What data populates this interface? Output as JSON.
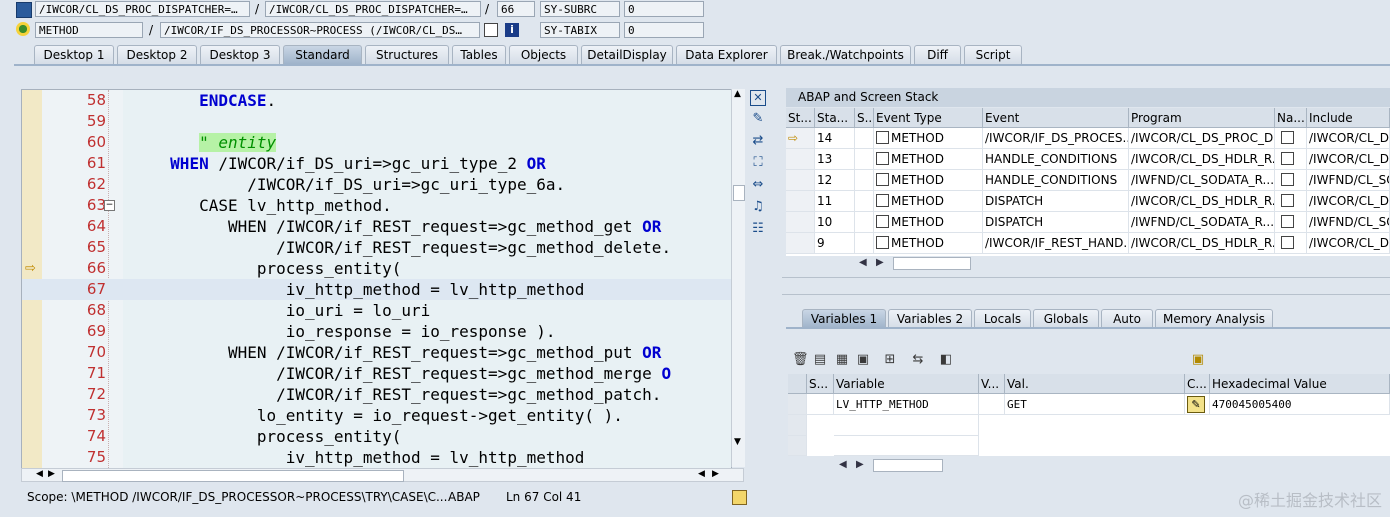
{
  "top_fields": {
    "row1": {
      "program": "/IWCOR/CL_DS_PROC_DISPATCHER=…",
      "include": "/IWCOR/CL_DS_PROC_DISPATCHER=…",
      "line": "66",
      "sysvar": "SY-SUBRC",
      "sysval": "0"
    },
    "row2": {
      "event_type": "METHOD",
      "event": "/IWCOR/IF_DS_PROCESSOR~PROCESS (/IWCOR/CL_DS…",
      "sysvar": "SY-TABIX",
      "sysval": "0"
    },
    "sep": "/",
    "info_icon": "i"
  },
  "tabs": [
    "Desktop 1",
    "Desktop 2",
    "Desktop 3",
    "Standard",
    "Structures",
    "Tables",
    "Objects",
    "DetailDisplay",
    "Data Explorer",
    "Break./Watchpoints",
    "Diff",
    "Script"
  ],
  "code": {
    "lines": [
      {
        "n": "58",
        "segs": [
          {
            "t": "        "
          },
          {
            "t": "ENDCASE",
            "c": "kw"
          },
          {
            "t": "."
          }
        ]
      },
      {
        "n": "59",
        "segs": [
          {
            "t": ""
          }
        ]
      },
      {
        "n": "60",
        "segs": [
          {
            "t": "        "
          },
          {
            "t": "\" entity",
            "c": "cm"
          }
        ]
      },
      {
        "n": "61",
        "segs": [
          {
            "t": "     "
          },
          {
            "t": "WHEN",
            "c": "kw"
          },
          {
            "t": " /IWCOR/if_DS_uri=>gc_uri_type_2 "
          },
          {
            "t": "OR",
            "c": "kw"
          }
        ]
      },
      {
        "n": "62",
        "segs": [
          {
            "t": "             /IWCOR/if_DS_uri=>gc_uri_type_6a."
          }
        ]
      },
      {
        "n": "63",
        "segs": [
          {
            "t": "        CASE lv_http_method."
          }
        ]
      },
      {
        "n": "64",
        "segs": [
          {
            "t": "           WHEN /IWCOR/if_REST_request=>gc_method_get "
          },
          {
            "t": "OR",
            "c": "kw"
          }
        ]
      },
      {
        "n": "65",
        "segs": [
          {
            "t": "                /IWCOR/if_REST_request=>gc_method_delete."
          }
        ]
      },
      {
        "n": "66",
        "segs": [
          {
            "t": "              process_entity( "
          }
        ]
      },
      {
        "n": "67",
        "segs": [
          {
            "t": "                 iv_http_method = lv_http_method"
          }
        ]
      },
      {
        "n": "68",
        "segs": [
          {
            "t": "                 io_uri = lo_uri"
          }
        ]
      },
      {
        "n": "69",
        "segs": [
          {
            "t": "                 io_response = io_response )."
          }
        ]
      },
      {
        "n": "70",
        "segs": [
          {
            "t": "           WHEN /IWCOR/if_REST_request=>gc_method_put "
          },
          {
            "t": "OR",
            "c": "kw"
          }
        ]
      },
      {
        "n": "71",
        "segs": [
          {
            "t": "                /IWCOR/if_REST_request=>gc_method_merge "
          },
          {
            "t": "O",
            "c": "kw"
          }
        ]
      },
      {
        "n": "72",
        "segs": [
          {
            "t": "                /IWCOR/if_REST_request=>gc_method_patch."
          }
        ]
      },
      {
        "n": "73",
        "segs": [
          {
            "t": "              lo_entity = io_request->get_entity( )."
          }
        ]
      },
      {
        "n": "74",
        "segs": [
          {
            "t": "              process_entity( "
          }
        ]
      },
      {
        "n": "75",
        "segs": [
          {
            "t": "                 iv_http_method = lv_http_method"
          }
        ]
      }
    ],
    "current_line": "66",
    "highlight_line": "67"
  },
  "status": {
    "scope": "Scope: \\METHOD /IWCOR/IF_DS_PROCESSOR~PROCESS\\TRY\\CASE\\C...",
    "lang": "ABAP",
    "pos": "Ln  67 Col  41"
  },
  "stack": {
    "title": "ABAP and Screen Stack",
    "headers": [
      "St...",
      "Sta...",
      "S...",
      "Event Type",
      "Event",
      "Program",
      "Na...",
      "Include"
    ],
    "rows": [
      {
        "level": "14",
        "type": "METHOD",
        "event": "/IWCOR/IF_DS_PROCES...",
        "program": "/IWCOR/CL_DS_PROC_D...",
        "include": "/IWCOR/CL_DS",
        "current": true
      },
      {
        "level": "13",
        "type": "METHOD",
        "event": "HANDLE_CONDITIONS",
        "program": "/IWCOR/CL_DS_HDLR_R...",
        "include": "/IWCOR/CL_DS",
        "current": false
      },
      {
        "level": "12",
        "type": "METHOD",
        "event": "HANDLE_CONDITIONS",
        "program": "/IWFND/CL_SODATA_R...",
        "include": "/IWFND/CL_SO",
        "current": false
      },
      {
        "level": "11",
        "type": "METHOD",
        "event": "DISPATCH",
        "program": "/IWCOR/CL_DS_HDLR_R...",
        "include": "/IWCOR/CL_DS",
        "current": false
      },
      {
        "level": "10",
        "type": "METHOD",
        "event": "DISPATCH",
        "program": "/IWFND/CL_SODATA_R...",
        "include": "/IWFND/CL_SO",
        "current": false
      },
      {
        "level": "9",
        "type": "METHOD",
        "event": "/IWCOR/IF_REST_HAND...",
        "program": "/IWCOR/CL_DS_HDLR_R...",
        "include": "/IWCOR/CL_DS",
        "current": false
      }
    ]
  },
  "var_tabs": [
    "Variables 1",
    "Variables 2",
    "Locals",
    "Globals",
    "Auto",
    "Memory Analysis"
  ],
  "vars": {
    "headers": [
      "S...",
      "Variable",
      "V...",
      "Val.",
      "C...",
      "Hexadecimal Value"
    ],
    "rows": [
      {
        "name": "LV_HTTP_METHOD",
        "value": "GET",
        "hex": "470045005400"
      }
    ]
  },
  "watermark": "@稀土掘金技术社区",
  "colors": {
    "keyword": "#0000d0",
    "comment_bg": "#b6f2a6",
    "line_number": "#c03030",
    "active_tab": "#9fb3ca"
  }
}
